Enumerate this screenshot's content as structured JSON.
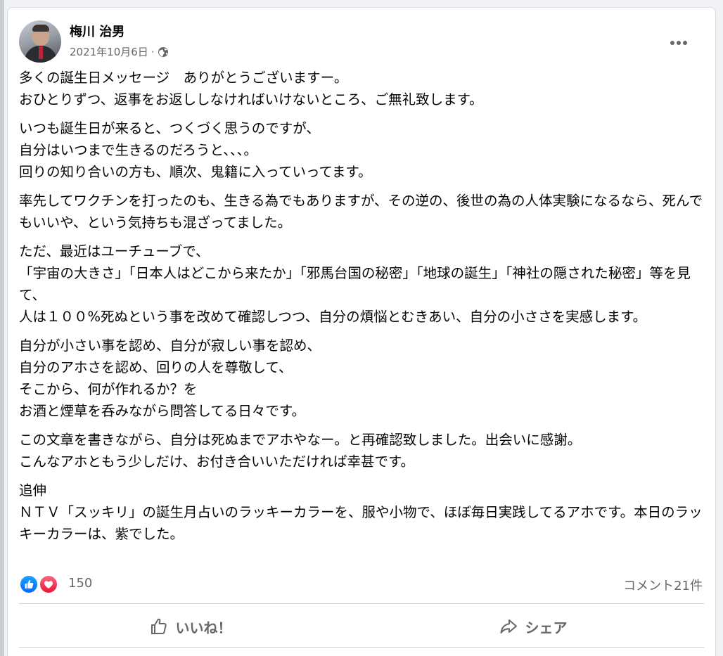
{
  "post": {
    "author": "梅川 治男",
    "date": "2021年10月6日",
    "dot": "·",
    "privacy_icon": "globe-icon",
    "more_icon": "more-options-icon",
    "paragraphs": [
      "多くの誕生日メッセージ　ありがとうございますー。\nおひとりずつ、返事をお返ししなければいけないところ、ご無礼致します。",
      "いつも誕生日が来ると、つくづく思うのですが、\n自分はいつまで生きるのだろうと、、、。\n回りの知り合いの方も、順次、鬼籍に入っていってます。",
      "率先してワクチンを打ったのも、生きる為でもありますが、その逆の、後世の為の人体実験になるなら、死んでもいいや、という気持ちも混ざってました。",
      "ただ、最近はユーチューブで、\n「宇宙の大きさ」「日本人はどこから来たか」「邪馬台国の秘密」「地球の誕生」「神社の隠された秘密」等を見て、\n人は１００%死ぬという事を改めて確認しつつ、自分の煩悩とむきあい、自分の小ささを実感します。",
      "自分が小さい事を認め、自分が寂しい事を認め、\n自分のアホさを認め、回りの人を尊敬して、\nそこから、何が作れるか？を\nお酒と煙草を呑みながら問答してる日々です。",
      "この文章を書きながら、自分は死ぬまでアホやなー。と再確認致しました。出会いに感謝。\nこんなアホともう少しだけ、お付き合いいただければ幸甚です。",
      "追伸\nＮＴＶ「スッキリ」の誕生月占いのラッキーカラーを、服や小物で、ほぼ毎日実践してるアホです。本日のラッキーカラーは、紫でした。"
    ]
  },
  "reactions": {
    "count": "150",
    "icons": [
      "like-icon",
      "love-icon"
    ],
    "comments": "コメント21件"
  },
  "actions": {
    "like_label": "いいね！",
    "share_label": "シェア"
  },
  "colors": {
    "like_blue": "#0866ff",
    "love_red": "#f33e58",
    "secondary_text": "#65676b"
  }
}
